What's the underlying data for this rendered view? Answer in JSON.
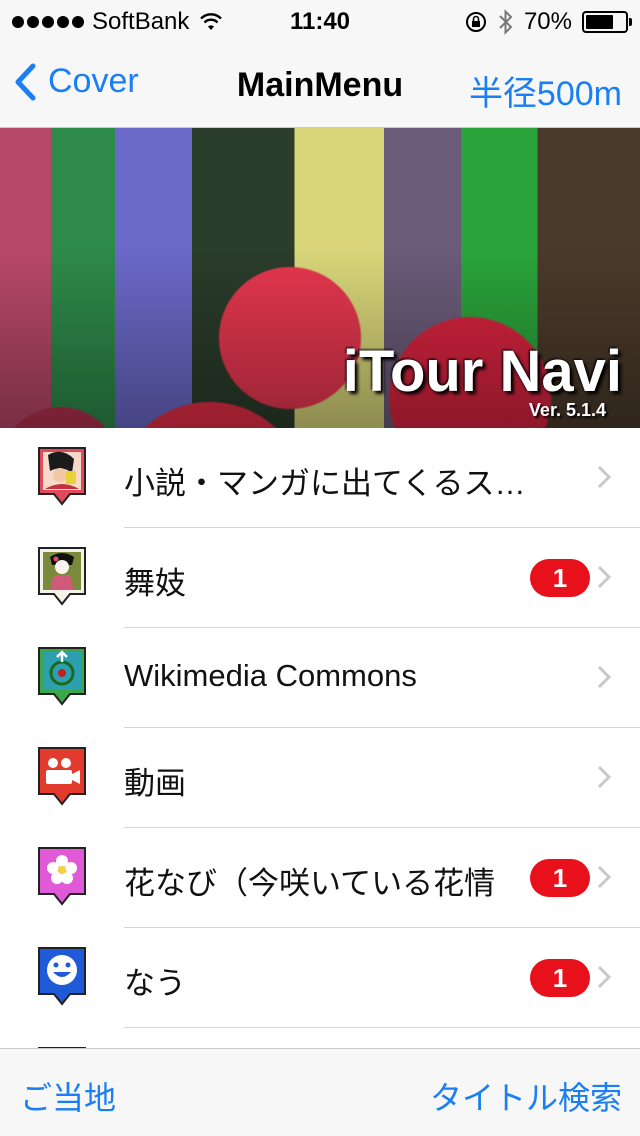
{
  "status_bar": {
    "carrier": "SoftBank",
    "time": "11:40",
    "battery": "70%",
    "battery_level": 0.7
  },
  "nav": {
    "back_label": "Cover",
    "title": "MainMenu",
    "right_label": "半径500m"
  },
  "banner": {
    "title": "iTour Navi",
    "version": "Ver. 5.1.4"
  },
  "menu": [
    {
      "label": "小説・マンガに出てくるス…",
      "badge": "",
      "icon": "novel-manga-icon"
    },
    {
      "label": "舞妓",
      "badge": "1",
      "icon": "maiko-icon"
    },
    {
      "label": "Wikimedia Commons",
      "badge": "",
      "icon": "wikimedia-commons-icon"
    },
    {
      "label": "動画",
      "badge": "",
      "icon": "video-camera-icon"
    },
    {
      "label": "花なび（今咲いている花情",
      "badge": "1",
      "icon": "flower-icon"
    },
    {
      "label": "なう",
      "badge": "1",
      "icon": "smiley-icon"
    }
  ],
  "toolbar": {
    "left_label": "ご当地",
    "right_label": "タイトル検索"
  },
  "colors": {
    "accent": "#1a7ff5",
    "badge": "#e8101a"
  }
}
